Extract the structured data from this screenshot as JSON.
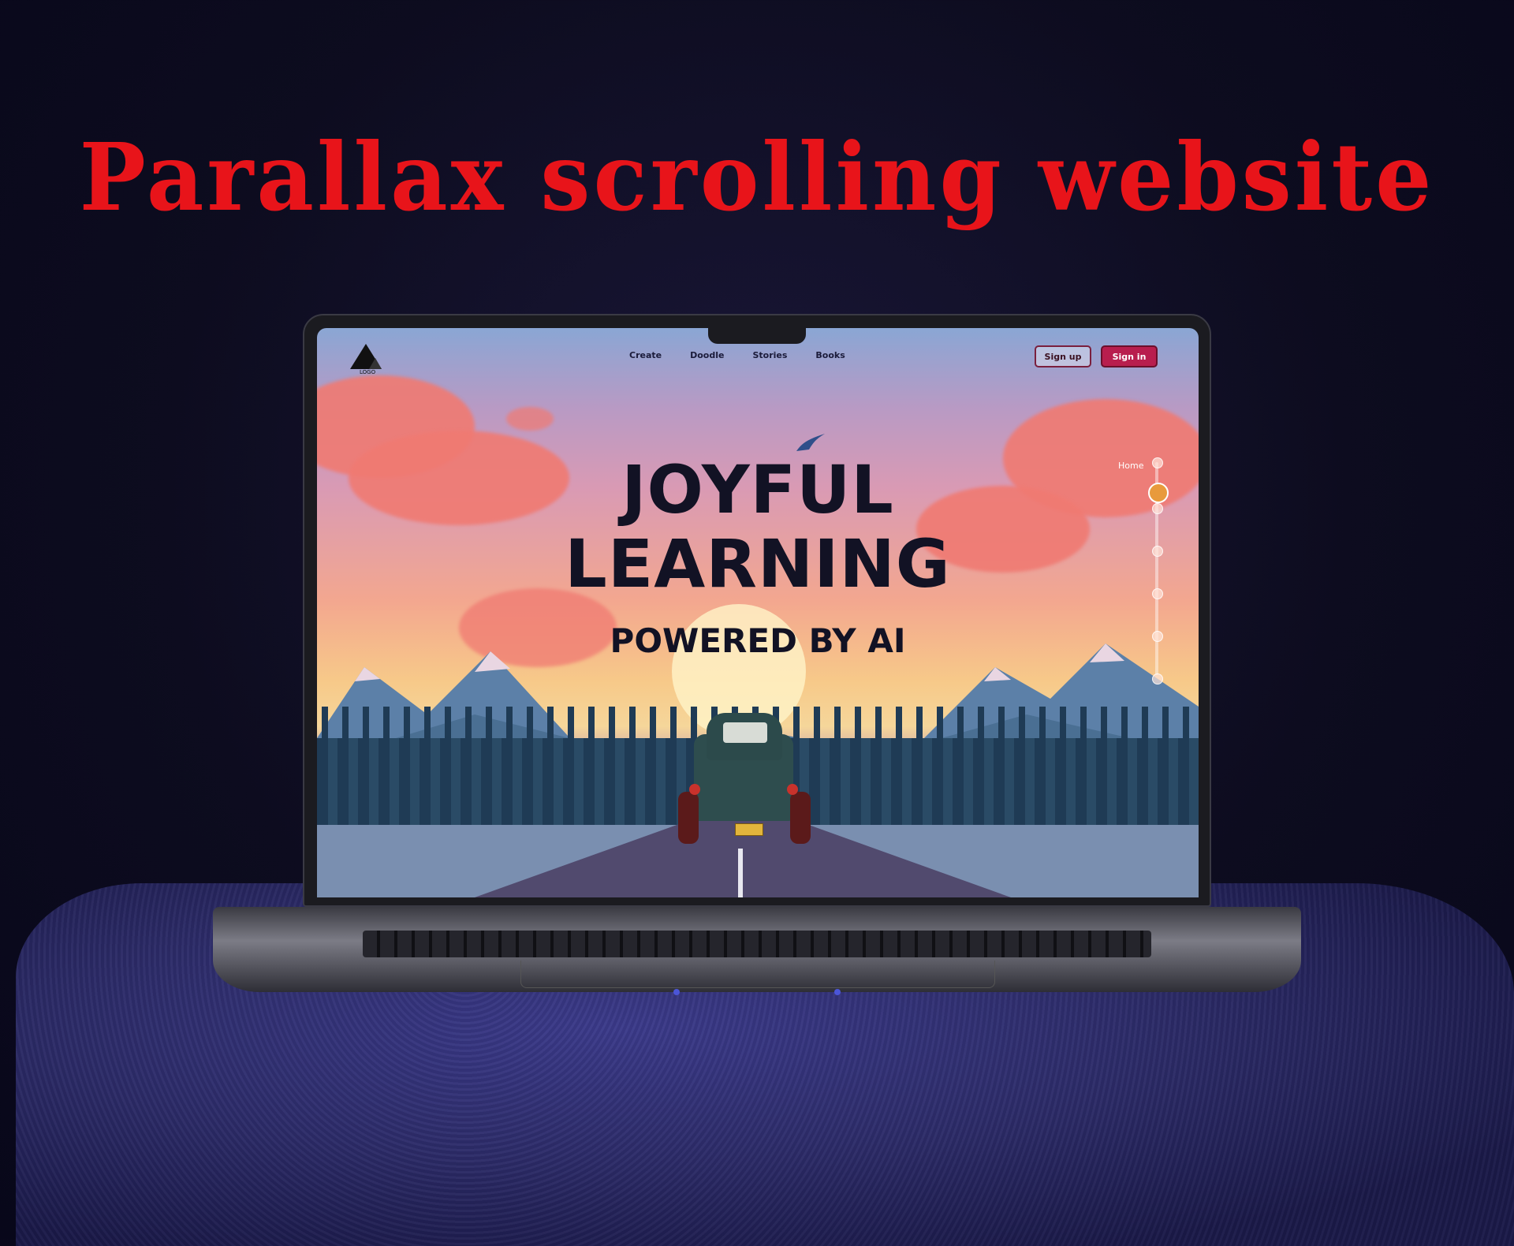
{
  "headline": "Parallax scrolling website",
  "site": {
    "logo_text": "LOGO",
    "nav": [
      "Create",
      "Doodle",
      "Stories",
      "Books"
    ],
    "signup_label": "Sign up",
    "signin_label": "Sign in",
    "hero_line1": "JOYFUL",
    "hero_line2": "LEARNING",
    "hero_line3": "POWERED BY AI",
    "side_nav_label": "Home"
  },
  "colors": {
    "headline": "#e8141a",
    "signin_bg": "#b81e4e",
    "hero_text": "#121224"
  }
}
